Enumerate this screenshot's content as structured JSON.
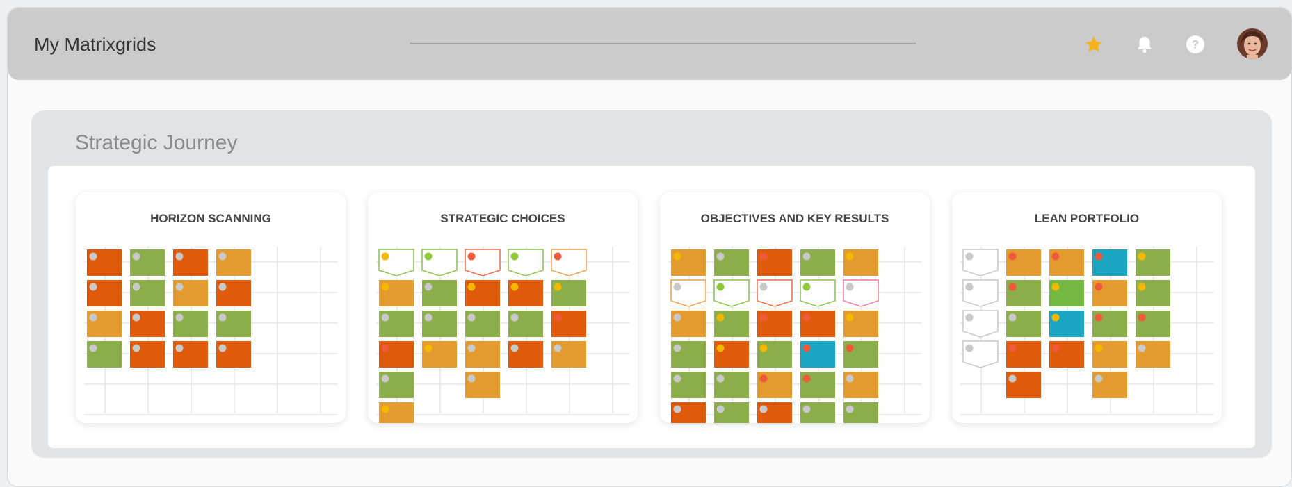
{
  "header": {
    "title": "My Matrixgrids",
    "icons": [
      "star-icon",
      "bell-icon",
      "help-icon",
      "user-avatar"
    ]
  },
  "panel": {
    "title": "Strategic Journey"
  },
  "colors": {
    "orange_red": "#e05a0c",
    "green": "#8bae4a",
    "amber": "#e39b2f",
    "teal": "#1aa5c0",
    "bright_green": "#74b843",
    "dot_grey": "#c9c9c9",
    "dot_yellow": "#f5b800",
    "dot_red": "#ef5a3b",
    "dot_green": "#8fc93a"
  },
  "cards": [
    {
      "title": "HORIZON SCANNING",
      "rows": [
        [
          "R:g",
          "G:g",
          "R:g",
          "A:g"
        ],
        [
          "R:g",
          "G:g",
          "A:g",
          "R:g"
        ],
        [
          "A:g",
          "R:g",
          "G:g",
          "G:g"
        ],
        [
          "G:g",
          "R:g",
          "R:g",
          "R:g"
        ]
      ]
    },
    {
      "title": "STRATEGIC CHOICES",
      "rows": [
        [
          "oG:y",
          "oG:g",
          "oR:r",
          "oG:g",
          "oA:r"
        ],
        [
          "A:y",
          "G:g",
          "R:y",
          "R:y",
          "G:y"
        ],
        [
          "G:g",
          "G:g",
          "G:g",
          "G:g",
          "R:r"
        ],
        [
          "R:r",
          "A:y",
          "A:g",
          "R:g",
          "A:g"
        ],
        [
          "G:g",
          "",
          "A:g",
          "",
          ""
        ],
        [
          "A:y",
          "",
          "",
          "",
          ""
        ]
      ]
    },
    {
      "title": "OBJECTIVES AND KEY RESULTS",
      "rows": [
        [
          "A:y",
          "G:g",
          "R:r",
          "G:g",
          "A:y"
        ],
        [
          "oA:g",
          "oG:g",
          "oR:g",
          "oG:g",
          "oP:g"
        ],
        [
          "A:g",
          "G:y",
          "R:r",
          "R:r",
          "A:y"
        ],
        [
          "G:g",
          "R:y",
          "G:y",
          "T:r",
          "G:r"
        ],
        [
          "G:g",
          "G:g",
          "A:r",
          "G:r",
          "A:g"
        ],
        [
          "R:g",
          "G:g",
          "R:g",
          "G:g",
          "G:g"
        ]
      ]
    },
    {
      "title": "LEAN PORTFOLIO",
      "rows": [
        [
          "oN:g",
          "A:r",
          "A:r",
          "T:r",
          "G:y"
        ],
        [
          "oN:g",
          "G:r",
          "B:y",
          "A:r",
          "G:y"
        ],
        [
          "oN:g",
          "G:g",
          "T:y",
          "G:r",
          "G:r"
        ],
        [
          "oN:g",
          "R:r",
          "R:r",
          "A:y",
          "A:g"
        ],
        [
          "",
          "R:g",
          "",
          "A:g",
          ""
        ]
      ]
    }
  ]
}
